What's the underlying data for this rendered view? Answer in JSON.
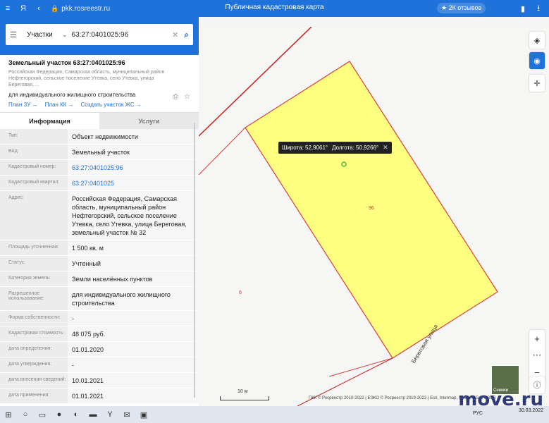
{
  "browser": {
    "url": "pkk.rosreestr.ru",
    "page_title": "Публичная кадастровая карта",
    "reviews": "★ 2К отзывов",
    "icons": [
      "menu-icon",
      "yandex-icon",
      "back-icon",
      "lock-icon",
      "bookmark-icon",
      "download-icon"
    ]
  },
  "search": {
    "type_label": "Участки",
    "query": "63:27:0401025:96"
  },
  "object": {
    "title": "Земельный участок 63:27:0401025:96",
    "address": "Российская Федерация, Самарская область, муниципальный район Нефтегорский, сельское поселение Утевка, село Утевка, улица Береговая, ...",
    "use": "для индивидуального жилищного строительства",
    "links": {
      "plan_zu": "План ЗУ →",
      "plan_kk": "План КК →",
      "create": "Создать участок ЖС →"
    }
  },
  "tabs": {
    "info": "Информация",
    "services": "Услуги"
  },
  "rows": [
    {
      "label": "Тип:",
      "value": "Объект недвижимости"
    },
    {
      "label": "Вид:",
      "value": "Земельный участок"
    },
    {
      "label": "Кадастровый номер:",
      "value": "63:27:0401025:96"
    },
    {
      "label": "Кадастровый квартал:",
      "value": "63:27:0401025"
    },
    {
      "label": "Адрес:",
      "value": "Российская Федерация, Самарская область, муниципальный район Нефтегорский, сельское поселение Утевка, село Утевка, улица Береговая, земельный участок № 32"
    },
    {
      "label": "Площадь уточненная:",
      "value": "1 500 кв. м"
    },
    {
      "label": "Статус:",
      "value": "Учтенный"
    },
    {
      "label": "Категория земель:",
      "value": "Земли населённых пунктов"
    },
    {
      "label": "Разрешенное использование:",
      "value": "для индивидуального жилищного строительства"
    },
    {
      "label": "Форма собственности:",
      "value": "-"
    },
    {
      "label": "Кадастровая стоимость:",
      "value": "48 075 руб."
    },
    {
      "label": "дата определения:",
      "value": "01.01.2020"
    },
    {
      "label": "дата утверждения:",
      "value": "-"
    },
    {
      "label": "дата внесения сведений:",
      "value": "10.01.2021"
    },
    {
      "label": "дата применения:",
      "value": "01.01.2021"
    }
  ],
  "map": {
    "coord_lat": "Широта: 52,9061°",
    "coord_lon": "Долгота: 50,9266°",
    "parcel_label": "96",
    "neighbor_label": "6",
    "street": "Береговая улица",
    "scale": "10 м",
    "copyright": "ПКК © Росреестр 2010-2022 | ЕЭКО © Росреестр 2019-2022 | Esri, Intermap, NASA, NGA, USGS",
    "minimap_label": "Снимки",
    "colors": {
      "parcel_fill": "#ffff80",
      "parcel_stroke": "#d84040",
      "boundary": "#c81e1e"
    }
  },
  "watermark": "move.ru",
  "taskbar": {
    "lang": "РУС",
    "date": "30.03.2022"
  }
}
